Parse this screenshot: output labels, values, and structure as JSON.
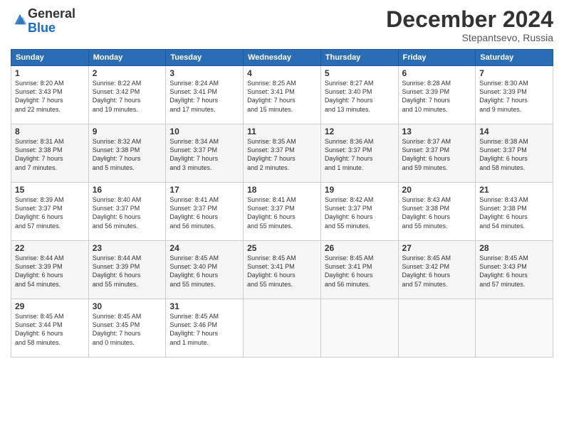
{
  "logo": {
    "general": "General",
    "blue": "Blue"
  },
  "title": "December 2024",
  "subtitle": "Stepantsevo, Russia",
  "days_of_week": [
    "Sunday",
    "Monday",
    "Tuesday",
    "Wednesday",
    "Thursday",
    "Friday",
    "Saturday"
  ],
  "weeks": [
    [
      {
        "day": "1",
        "info": "Sunrise: 8:20 AM\nSunset: 3:43 PM\nDaylight: 7 hours\nand 22 minutes."
      },
      {
        "day": "2",
        "info": "Sunrise: 8:22 AM\nSunset: 3:42 PM\nDaylight: 7 hours\nand 19 minutes."
      },
      {
        "day": "3",
        "info": "Sunrise: 8:24 AM\nSunset: 3:41 PM\nDaylight: 7 hours\nand 17 minutes."
      },
      {
        "day": "4",
        "info": "Sunrise: 8:25 AM\nSunset: 3:41 PM\nDaylight: 7 hours\nand 15 minutes."
      },
      {
        "day": "5",
        "info": "Sunrise: 8:27 AM\nSunset: 3:40 PM\nDaylight: 7 hours\nand 13 minutes."
      },
      {
        "day": "6",
        "info": "Sunrise: 8:28 AM\nSunset: 3:39 PM\nDaylight: 7 hours\nand 10 minutes."
      },
      {
        "day": "7",
        "info": "Sunrise: 8:30 AM\nSunset: 3:39 PM\nDaylight: 7 hours\nand 9 minutes."
      }
    ],
    [
      {
        "day": "8",
        "info": "Sunrise: 8:31 AM\nSunset: 3:38 PM\nDaylight: 7 hours\nand 7 minutes."
      },
      {
        "day": "9",
        "info": "Sunrise: 8:32 AM\nSunset: 3:38 PM\nDaylight: 7 hours\nand 5 minutes."
      },
      {
        "day": "10",
        "info": "Sunrise: 8:34 AM\nSunset: 3:37 PM\nDaylight: 7 hours\nand 3 minutes."
      },
      {
        "day": "11",
        "info": "Sunrise: 8:35 AM\nSunset: 3:37 PM\nDaylight: 7 hours\nand 2 minutes."
      },
      {
        "day": "12",
        "info": "Sunrise: 8:36 AM\nSunset: 3:37 PM\nDaylight: 7 hours\nand 1 minute."
      },
      {
        "day": "13",
        "info": "Sunrise: 8:37 AM\nSunset: 3:37 PM\nDaylight: 6 hours\nand 59 minutes."
      },
      {
        "day": "14",
        "info": "Sunrise: 8:38 AM\nSunset: 3:37 PM\nDaylight: 6 hours\nand 58 minutes."
      }
    ],
    [
      {
        "day": "15",
        "info": "Sunrise: 8:39 AM\nSunset: 3:37 PM\nDaylight: 6 hours\nand 57 minutes."
      },
      {
        "day": "16",
        "info": "Sunrise: 8:40 AM\nSunset: 3:37 PM\nDaylight: 6 hours\nand 56 minutes."
      },
      {
        "day": "17",
        "info": "Sunrise: 8:41 AM\nSunset: 3:37 PM\nDaylight: 6 hours\nand 56 minutes."
      },
      {
        "day": "18",
        "info": "Sunrise: 8:41 AM\nSunset: 3:37 PM\nDaylight: 6 hours\nand 55 minutes."
      },
      {
        "day": "19",
        "info": "Sunrise: 8:42 AM\nSunset: 3:37 PM\nDaylight: 6 hours\nand 55 minutes."
      },
      {
        "day": "20",
        "info": "Sunrise: 8:43 AM\nSunset: 3:38 PM\nDaylight: 6 hours\nand 55 minutes."
      },
      {
        "day": "21",
        "info": "Sunrise: 8:43 AM\nSunset: 3:38 PM\nDaylight: 6 hours\nand 54 minutes."
      }
    ],
    [
      {
        "day": "22",
        "info": "Sunrise: 8:44 AM\nSunset: 3:39 PM\nDaylight: 6 hours\nand 54 minutes."
      },
      {
        "day": "23",
        "info": "Sunrise: 8:44 AM\nSunset: 3:39 PM\nDaylight: 6 hours\nand 55 minutes."
      },
      {
        "day": "24",
        "info": "Sunrise: 8:45 AM\nSunset: 3:40 PM\nDaylight: 6 hours\nand 55 minutes."
      },
      {
        "day": "25",
        "info": "Sunrise: 8:45 AM\nSunset: 3:41 PM\nDaylight: 6 hours\nand 55 minutes."
      },
      {
        "day": "26",
        "info": "Sunrise: 8:45 AM\nSunset: 3:41 PM\nDaylight: 6 hours\nand 56 minutes."
      },
      {
        "day": "27",
        "info": "Sunrise: 8:45 AM\nSunset: 3:42 PM\nDaylight: 6 hours\nand 57 minutes."
      },
      {
        "day": "28",
        "info": "Sunrise: 8:45 AM\nSunset: 3:43 PM\nDaylight: 6 hours\nand 57 minutes."
      }
    ],
    [
      {
        "day": "29",
        "info": "Sunrise: 8:45 AM\nSunset: 3:44 PM\nDaylight: 6 hours\nand 58 minutes."
      },
      {
        "day": "30",
        "info": "Sunrise: 8:45 AM\nSunset: 3:45 PM\nDaylight: 7 hours\nand 0 minutes."
      },
      {
        "day": "31",
        "info": "Sunrise: 8:45 AM\nSunset: 3:46 PM\nDaylight: 7 hours\nand 1 minute."
      },
      {
        "day": "",
        "info": ""
      },
      {
        "day": "",
        "info": ""
      },
      {
        "day": "",
        "info": ""
      },
      {
        "day": "",
        "info": ""
      }
    ]
  ]
}
